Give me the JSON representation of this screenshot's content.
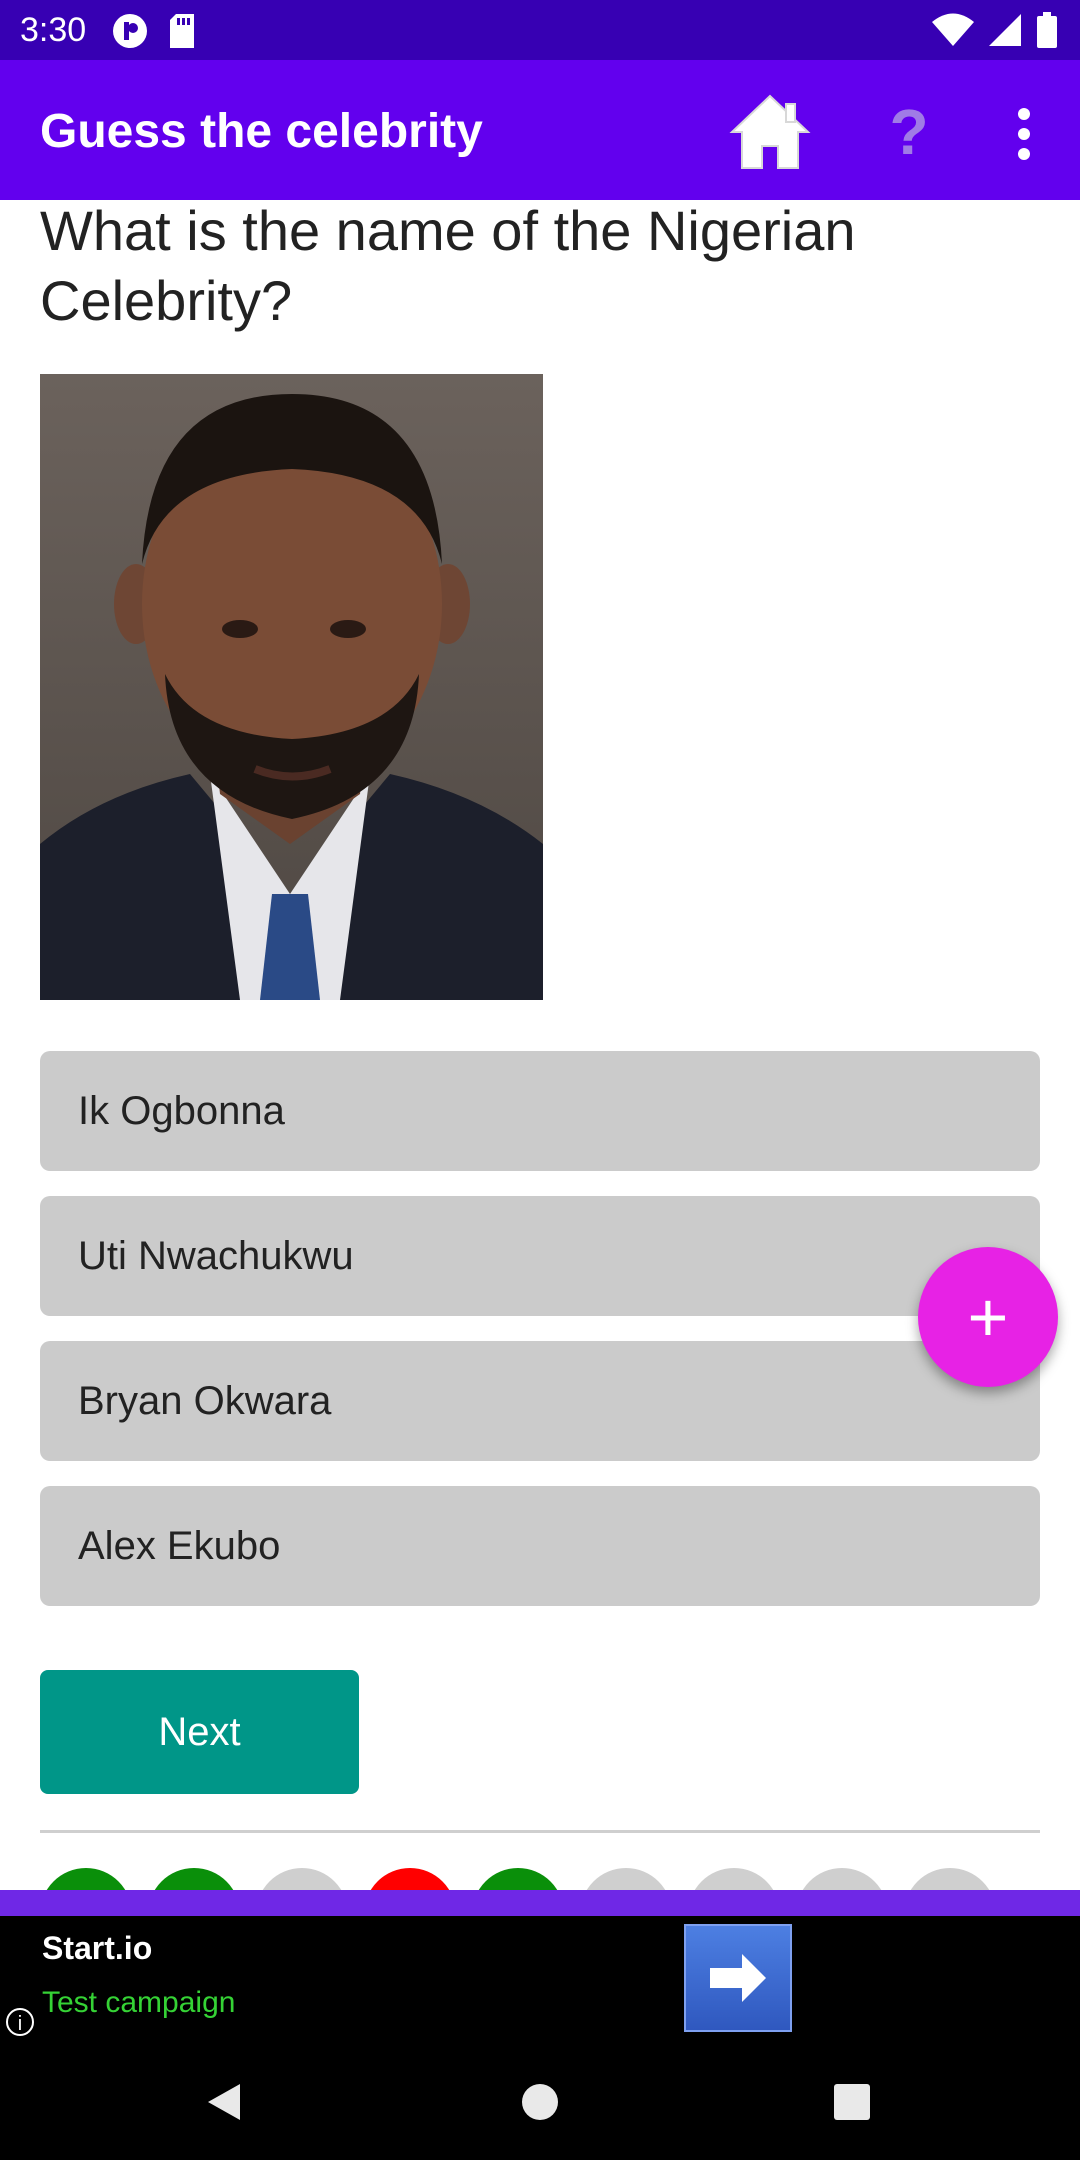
{
  "status_bar": {
    "time": "3:30"
  },
  "app_bar": {
    "title": "Guess the celebrity",
    "help_symbol": "?"
  },
  "quiz": {
    "question": "What is the name of the Nigerian Celebrity?",
    "options": [
      "Ik Ogbonna",
      "Uti Nwachukwu",
      "Bryan Okwara",
      "Alex Ekubo"
    ],
    "next_label": "Next",
    "fab_symbol": "+",
    "progress_dots": [
      "correct",
      "correct",
      "unanswered",
      "wrong",
      "correct",
      "unanswered",
      "unanswered",
      "unanswered",
      "unanswered"
    ]
  },
  "colors": {
    "status_bar": "#3700b3",
    "app_bar": "#6200ee",
    "option_bg": "#cbcbcb",
    "next_button": "#009688",
    "fab": "#e722e5",
    "dot_correct": "#0a8f0a",
    "dot_wrong": "#ff0000",
    "dot_unanswered": "#cfcfcf"
  },
  "ad": {
    "brand": "Start.io",
    "subtitle": "Test campaign",
    "info_symbol": "i"
  }
}
